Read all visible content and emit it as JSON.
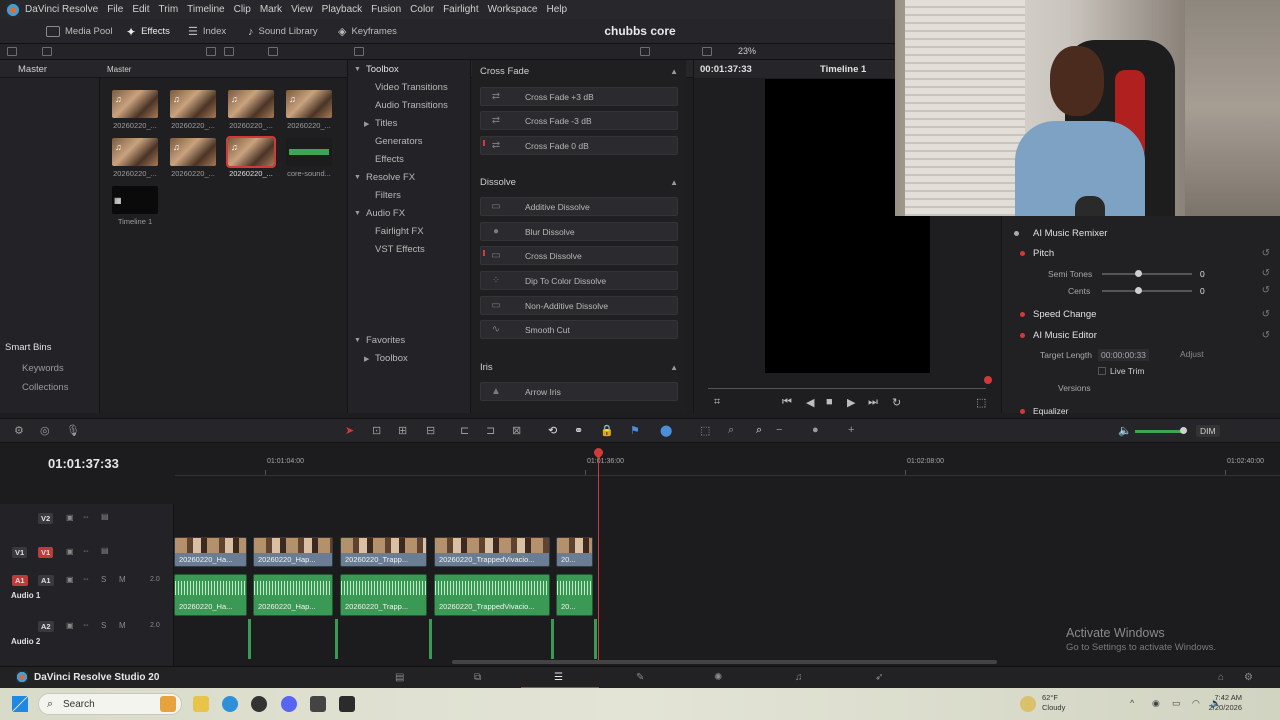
{
  "menu": {
    "app_name": "DaVinci Resolve",
    "items": [
      "File",
      "Edit",
      "Trim",
      "Timeline",
      "Clip",
      "Mark",
      "View",
      "Playback",
      "Fusion",
      "Color",
      "Fairlight",
      "Workspace",
      "Help"
    ]
  },
  "toolbar": {
    "media_pool": "Media Pool",
    "effects": "Effects",
    "index": "Index",
    "sound_library": "Sound Library",
    "keyframes": "Keyframes",
    "zoom": "23%"
  },
  "project_title": "chubbs core",
  "panels": {
    "bins_header": "Master",
    "pool_header": "Master"
  },
  "smart_bins": {
    "title": "Smart Bins",
    "items": [
      "Keywords",
      "Collections"
    ]
  },
  "media_pool": {
    "clips": [
      {
        "label": "20260220_..."
      },
      {
        "label": "20260220_..."
      },
      {
        "label": "20260220_..."
      },
      {
        "label": "20260220_..."
      },
      {
        "label": "20260220_..."
      },
      {
        "label": "20260220_..."
      },
      {
        "label": "20260220_..."
      },
      {
        "label": "core-sound..."
      },
      {
        "label": "Timeline 1"
      }
    ]
  },
  "effects_tree": {
    "toolbox": "Toolbox",
    "video_transitions": "Video Transitions",
    "audio_transitions": "Audio Transitions",
    "titles": "Titles",
    "generators": "Generators",
    "effects": "Effects",
    "resolve_fx": "Resolve FX",
    "filters": "Filters",
    "audio_fx": "Audio FX",
    "fairlight_fx": "Fairlight FX",
    "vst_effects": "VST Effects",
    "favorites": "Favorites",
    "fav_toolbox": "Toolbox"
  },
  "effects_list": {
    "cross_fade_header": "Cross Fade",
    "cross_fade": [
      "Cross Fade +3 dB",
      "Cross Fade -3 dB",
      "Cross Fade 0 dB"
    ],
    "dissolve_header": "Dissolve",
    "dissolve": [
      "Additive Dissolve",
      "Blur Dissolve",
      "Cross Dissolve",
      "Dip To Color Dissolve",
      "Non-Additive Dissolve",
      "Smooth Cut"
    ],
    "iris_header": "Iris",
    "iris": [
      "Arrow Iris"
    ]
  },
  "viewer": {
    "timecode": "00:01:37:33",
    "timeline_name": "Timeline 1"
  },
  "inspector": {
    "ai_music_remixer": "AI Music Remixer",
    "pitch": "Pitch",
    "semi_tones_label": "Semi Tones",
    "semi_tones_value": "0",
    "cents_label": "Cents",
    "cents_value": "0",
    "speed_change": "Speed Change",
    "ai_music_editor": "AI Music Editor",
    "target_length_label": "Target Length",
    "target_length_value": "00:00:00:33",
    "adjust": "Adjust",
    "live_trim": "Live Trim",
    "versions": "Versions",
    "equalizer": "Equalizer"
  },
  "timeline": {
    "timecode": "01:01:37:33",
    "ruler": [
      "01:01:04:00",
      "01:01:36:00",
      "01:02:08:00",
      "01:02:40:00"
    ],
    "tracks": {
      "v2": "V2",
      "v1": "V1",
      "a1": "A1",
      "a1_name": "Audio 1",
      "a1_level": "2.0",
      "a2": "A2",
      "a2_name": "Audio 2",
      "a2_level": "2.0"
    },
    "video_clips": [
      "20260220_Ha...",
      "20260220_Hap...",
      "20260220_Trapp...",
      "20260220_TrappedVivacio...",
      "20..."
    ],
    "audio_clips": [
      "20260220_Ha...",
      "20260220_Hap...",
      "20260220_Trapp...",
      "20260220_TrappedVivacio...",
      "20..."
    ],
    "dim": "DIM"
  },
  "watermark": {
    "line1": "Activate Windows",
    "line2": "Go to Settings to activate Windows."
  },
  "pagebar": {
    "brand": "DaVinci Resolve Studio 20"
  },
  "taskbar": {
    "search": "Search",
    "weather_temp": "62°F",
    "weather_desc": "Cloudy",
    "time": "7:42 AM",
    "date": "2/20/2026"
  },
  "colors": {
    "accent_red": "#d23a3a",
    "audio_green": "#3a9a55",
    "video_blue": "#6b7d93"
  }
}
